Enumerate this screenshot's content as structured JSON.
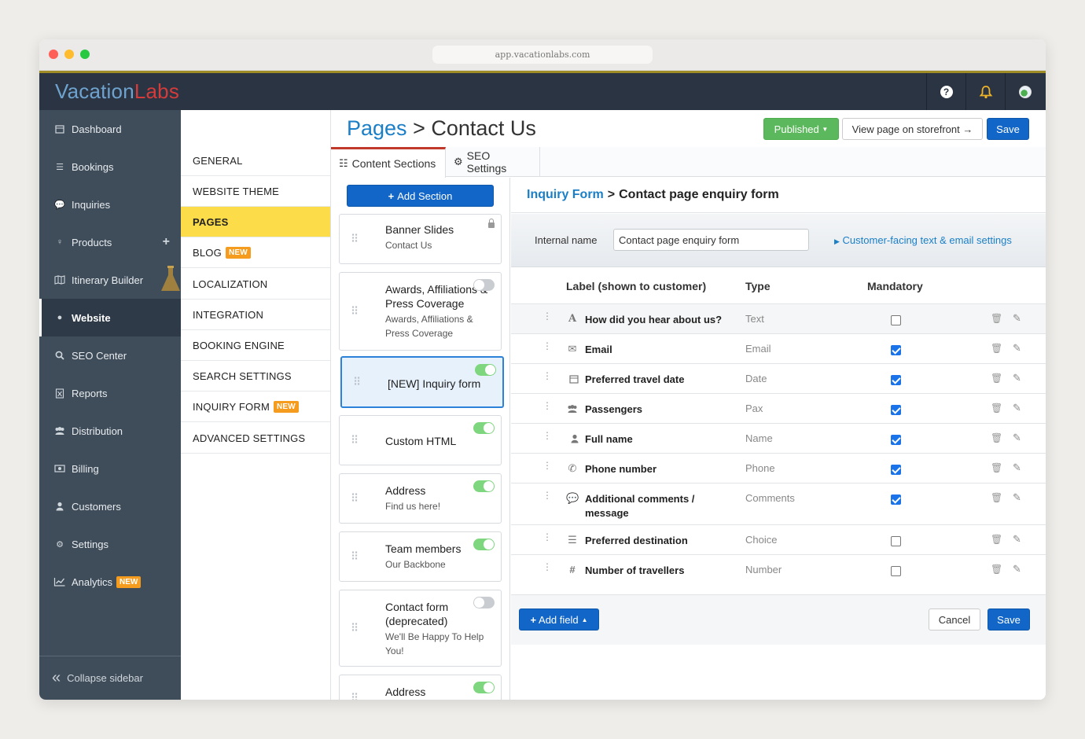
{
  "browser": {
    "url": "app.vacationlabs.com"
  },
  "brand": {
    "part1": "Vacation",
    "part2": "Labs"
  },
  "topbar": {
    "help_icon": "question-circle-icon",
    "bell_icon": "bell-icon",
    "globe_icon": "globe-icon"
  },
  "sidebar": {
    "items": [
      {
        "label": "Dashboard",
        "icon": "calendar-icon"
      },
      {
        "label": "Bookings",
        "icon": "list-icon"
      },
      {
        "label": "Inquiries",
        "icon": "comment-icon"
      },
      {
        "label": "Products",
        "icon": "lightbulb-icon"
      },
      {
        "label": "Itinerary Builder",
        "icon": "map-icon"
      },
      {
        "label": "Website",
        "icon": "globe-icon"
      },
      {
        "label": "SEO Center",
        "icon": "search-icon"
      },
      {
        "label": "Reports",
        "icon": "file-excel-icon"
      },
      {
        "label": "Distribution",
        "icon": "users-icon"
      },
      {
        "label": "Billing",
        "icon": "money-icon"
      },
      {
        "label": "Customers",
        "icon": "user-icon"
      },
      {
        "label": "Settings",
        "icon": "gear-icon"
      },
      {
        "label": "Analytics",
        "icon": "line-chart-icon"
      }
    ],
    "new_badge": "NEW",
    "products_plus": "+",
    "collapse_label": "Collapse sidebar"
  },
  "subnav": {
    "items": [
      {
        "label": "GENERAL"
      },
      {
        "label": "WEBSITE THEME"
      },
      {
        "label": "PAGES"
      },
      {
        "label": "BLOG"
      },
      {
        "label": "LOCALIZATION"
      },
      {
        "label": "INTEGRATION"
      },
      {
        "label": "BOOKING ENGINE"
      },
      {
        "label": "SEARCH SETTINGS"
      },
      {
        "label": "INQUIRY FORM"
      },
      {
        "label": "ADVANCED SETTINGS"
      }
    ],
    "new_badge": "NEW"
  },
  "header": {
    "breadcrumb_link": "Pages",
    "separator": ">",
    "title": "Contact Us",
    "published_label": "Published",
    "view_label": "View page on storefront →",
    "save_label": "Save"
  },
  "tabs": [
    {
      "label": "Content Sections",
      "icon": "list-icon"
    },
    {
      "label": "SEO Settings",
      "icon": "gear-icon"
    }
  ],
  "sections": {
    "add_label": "Add Section",
    "cards": [
      {
        "title": "Banner Slides",
        "subtitle": "Contact Us",
        "state": "locked"
      },
      {
        "title": "Awards, Affiliations & Press Coverage",
        "subtitle": "Awards, Affiliations & Press Coverage",
        "state": "off"
      },
      {
        "title": "[NEW] Inquiry form",
        "subtitle": "",
        "state": "on"
      },
      {
        "title": "Custom HTML",
        "subtitle": "",
        "state": "on"
      },
      {
        "title": "Address",
        "subtitle": "Find us here!",
        "state": "on"
      },
      {
        "title": "Team members",
        "subtitle": "Our Backbone",
        "state": "on"
      },
      {
        "title": "Contact form (deprecated)",
        "subtitle": "We'll Be Happy To Help You!",
        "state": "off"
      },
      {
        "title": "Address",
        "subtitle": "",
        "state": "on"
      }
    ]
  },
  "form": {
    "crumb_link": "Inquiry Form",
    "crumb_sep": ">",
    "crumb_title": "Contact page enquiry form",
    "internal_name_label": "Internal name",
    "internal_name_value": "Contact page enquiry form",
    "customer_link": "Customer-facing text & email settings",
    "columns": {
      "label": "Label (shown to customer)",
      "type": "Type",
      "mandatory": "Mandatory"
    },
    "fields": [
      {
        "label": "How did you hear about us?",
        "type": "Text",
        "icon": "font-icon",
        "mandatory": false
      },
      {
        "label": "Email",
        "type": "Email",
        "icon": "envelope-icon",
        "mandatory": true
      },
      {
        "label": "Preferred travel date",
        "type": "Date",
        "icon": "calendar-icon",
        "mandatory": true
      },
      {
        "label": "Passengers",
        "type": "Pax",
        "icon": "users-icon",
        "mandatory": true
      },
      {
        "label": "Full name",
        "type": "Name",
        "icon": "user-icon",
        "mandatory": true
      },
      {
        "label": "Phone number",
        "type": "Phone",
        "icon": "phone-icon",
        "mandatory": true
      },
      {
        "label": "Additional comments / message",
        "type": "Comments",
        "icon": "comment-icon",
        "mandatory": true
      },
      {
        "label": "Preferred destination",
        "type": "Choice",
        "icon": "list-icon",
        "mandatory": false
      },
      {
        "label": "Number of travellers",
        "type": "Number",
        "icon": "hash-icon",
        "mandatory": false
      }
    ],
    "add_field_label": "Add field",
    "cancel_label": "Cancel",
    "save_label": "Save"
  },
  "colors": {
    "primary": "#1166c8",
    "success": "#5cb85c",
    "accent_yellow": "#fddc4a",
    "sidebar": "#3f4c5a",
    "topbar": "#2a3442"
  }
}
